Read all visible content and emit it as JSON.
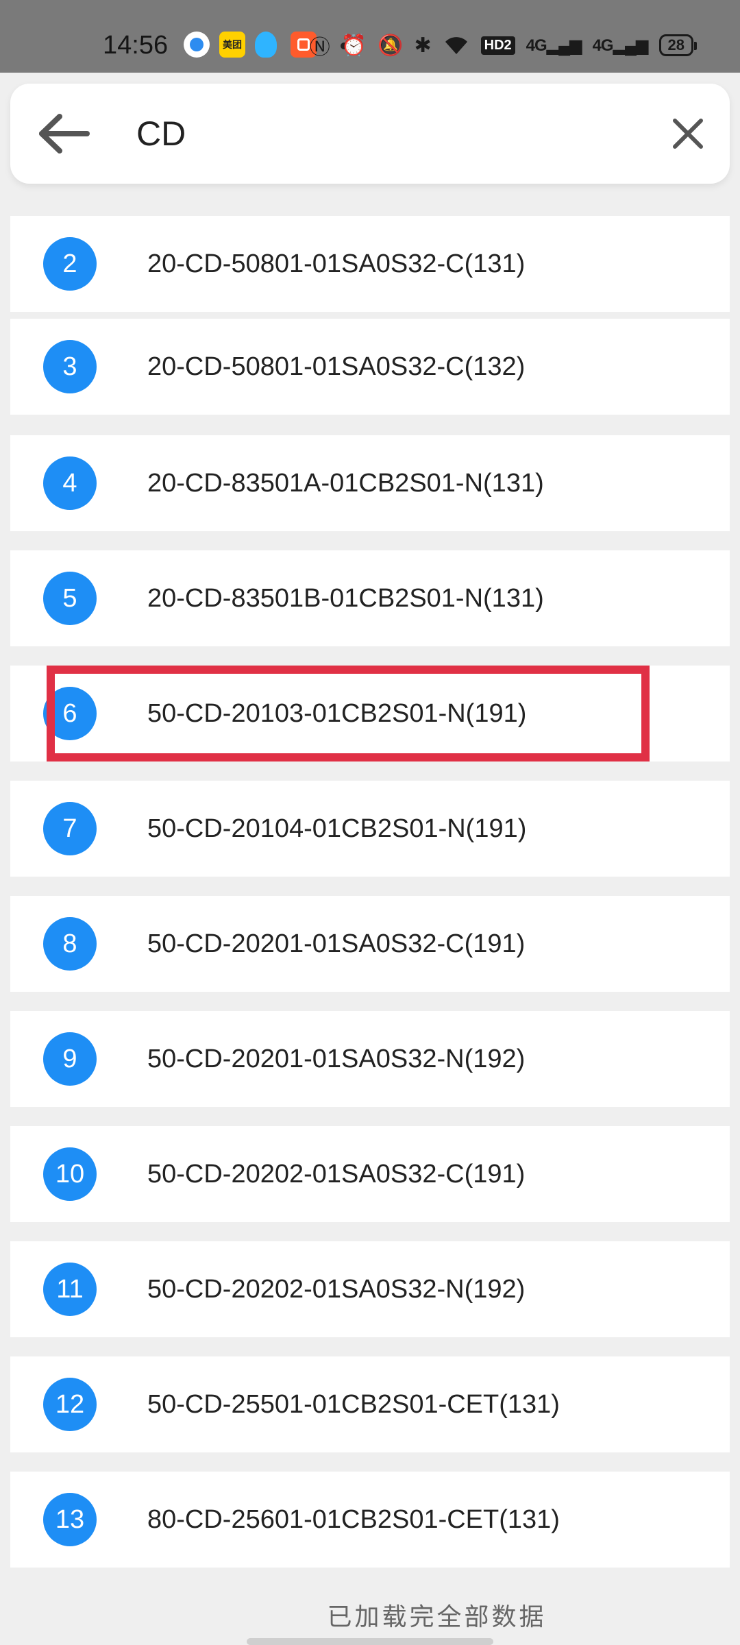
{
  "status_bar": {
    "time": "14:56",
    "meituan_label": "美团",
    "network_hd": "HD2",
    "signal_1": "4G",
    "signal_2": "4G",
    "battery": "28"
  },
  "search": {
    "query": "CD"
  },
  "results": [
    {
      "index": "2",
      "code": "20-CD-50801-01SA0S32-C(131)"
    },
    {
      "index": "3",
      "code": "20-CD-50801-01SA0S32-C(132)"
    },
    {
      "index": "4",
      "code": "20-CD-83501A-01CB2S01-N(131)"
    },
    {
      "index": "5",
      "code": "20-CD-83501B-01CB2S01-N(131)"
    },
    {
      "index": "6",
      "code": "50-CD-20103-01CB2S01-N(191)"
    },
    {
      "index": "7",
      "code": "50-CD-20104-01CB2S01-N(191)"
    },
    {
      "index": "8",
      "code": "50-CD-20201-01SA0S32-C(191)"
    },
    {
      "index": "9",
      "code": "50-CD-20201-01SA0S32-N(192)"
    },
    {
      "index": "10",
      "code": "50-CD-20202-01SA0S32-C(191)"
    },
    {
      "index": "11",
      "code": "50-CD-20202-01SA0S32-N(192)"
    },
    {
      "index": "12",
      "code": "50-CD-25501-01CB2S01-CET(131)"
    },
    {
      "index": "13",
      "code": "80-CD-25601-01CB2S01-CET(131)"
    }
  ],
  "footer": {
    "text": "已加载完全部数据"
  },
  "colors": {
    "badge": "#1e8ef5",
    "highlight": "#e03045"
  }
}
